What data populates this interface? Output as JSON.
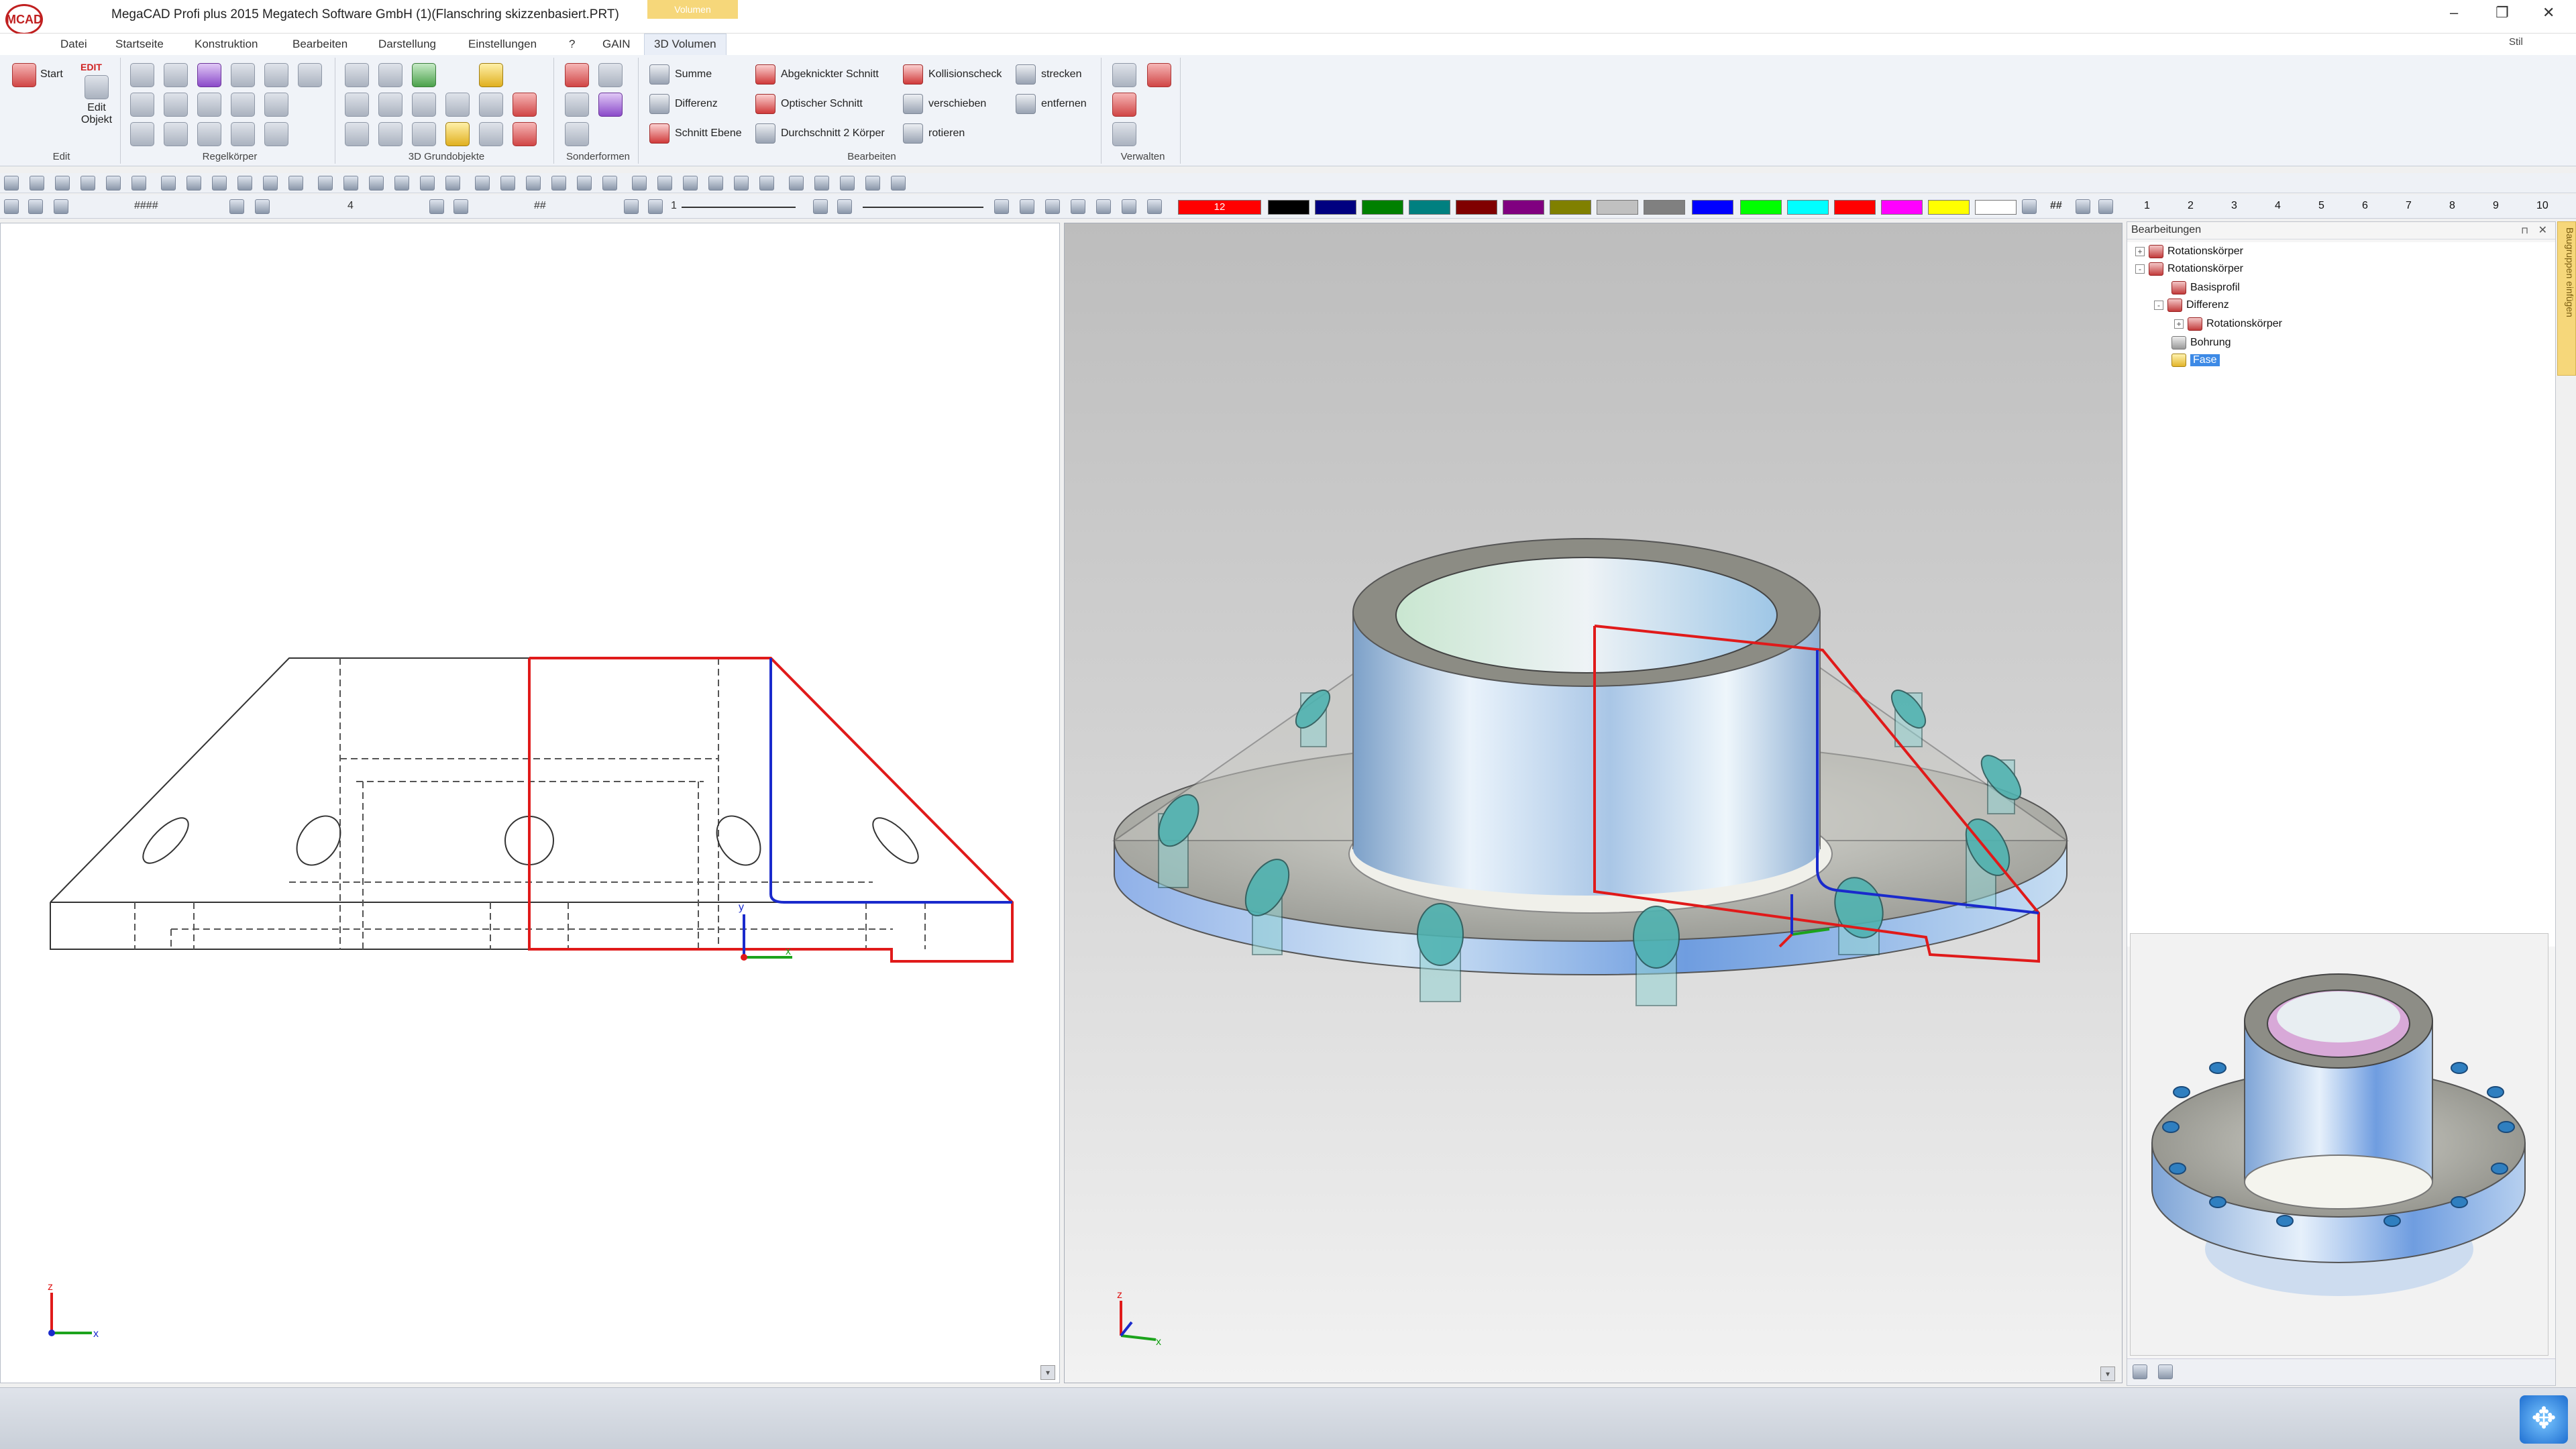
{
  "app": {
    "title": "MegaCAD Profi plus 2015  Megatech Software GmbH (1)(Flanschring skizzenbasiert.PRT)",
    "logo_text": "MCAD",
    "context_tab": "Volumen",
    "style_label": "Stil"
  },
  "menu": {
    "items": [
      "Datei",
      "Startseite",
      "Konstruktion",
      "Bearbeiten",
      "Darstellung",
      "Einstellungen",
      "?",
      "GAIN",
      "3D Volumen"
    ],
    "active_index": 8
  },
  "ribbon": {
    "groups": {
      "edit": {
        "label": "Edit",
        "start_label": "Start",
        "edit_label": "Edit Objekt",
        "edit_badge": "EDIT"
      },
      "regelkoerper": {
        "label": "Regelkörper"
      },
      "grundobjekte": {
        "label": "3D Grundobjekte"
      },
      "sonderformen": {
        "label": "Sonderformen"
      },
      "bearbeiten": {
        "label": "Bearbeiten",
        "buttons": [
          "Summe",
          "Differenz",
          "Schnitt Ebene",
          "Abgeknickter Schnitt",
          "Optischer Schnitt",
          "Durchschnitt 2 Körper",
          "Kollisionscheck",
          "verschieben",
          "rotieren",
          "strecken",
          "entfernen"
        ]
      },
      "verwalten": {
        "label": "Verwalten"
      }
    }
  },
  "toolbar3": {
    "pattern_label": "####",
    "layer_value": "4",
    "line_label": "##",
    "width_value": "1",
    "color_number": "12",
    "hash_label": "##",
    "colors": [
      "#ff0000",
      "#000000",
      "#000080",
      "#008000",
      "#008080",
      "#800000",
      "#800080",
      "#808000",
      "#c0c0c0",
      "#808080",
      "#0000ff",
      "#00ff00",
      "#00ffff",
      "#ff0000",
      "#ff00ff",
      "#ffff00",
      "#ffffff"
    ],
    "layer_numbers": [
      "1",
      "2",
      "3",
      "4",
      "5",
      "6",
      "7",
      "8",
      "9",
      "10"
    ]
  },
  "panel": {
    "title": "Bearbeitungen",
    "side_tab": "Baugruppen einfügen",
    "tree": [
      {
        "label": "Rotationskörper",
        "level": 0,
        "expander": "+"
      },
      {
        "label": "Rotationskörper",
        "level": 0,
        "expander": "-"
      },
      {
        "label": "Basisprofil",
        "level": 1,
        "expander": ""
      },
      {
        "label": "Differenz",
        "level": 1,
        "expander": "-"
      },
      {
        "label": "Rotationskörper",
        "level": 2,
        "expander": "+"
      },
      {
        "label": "Bohrung",
        "level": 1,
        "expander": ""
      },
      {
        "label": "Fase",
        "level": 1,
        "expander": "",
        "selected": true
      }
    ]
  },
  "viewports": {
    "axis_x": "x",
    "axis_y": "y",
    "axis_z": "z"
  }
}
